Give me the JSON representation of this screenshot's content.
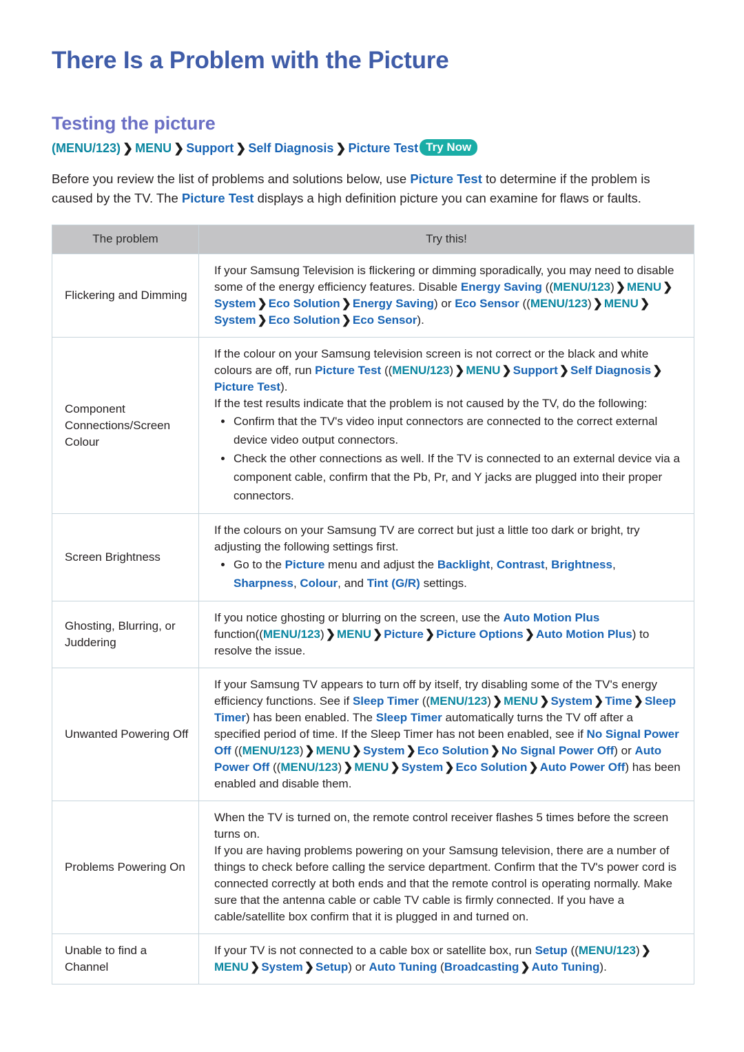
{
  "page": {
    "title": "There Is a Problem with the Picture",
    "section_title": "Testing the picture"
  },
  "breadcrumb": {
    "parts": [
      "(MENU/123)",
      "MENU",
      "Support",
      "Self Diagnosis",
      "Picture Test"
    ],
    "separator": "❯",
    "badge": "Try Now"
  },
  "intro": {
    "t1": "Before you review the list of problems and solutions below, use ",
    "k1": "Picture Test",
    "t2": " to determine if the problem is caused by the TV. The ",
    "k2": "Picture Test",
    "t3": " displays a high definition picture you can examine for flaws or faults."
  },
  "table": {
    "headers": [
      "The problem",
      "Try this!"
    ],
    "rows": [
      {
        "problem": "Flickering and Dimming",
        "solution_plain": "If your Samsung Television is flickering or dimming sporadically, you may need to disable some of the energy efficiency features. Disable Energy Saving ((MENU/123) ❯ MENU ❯ System ❯ Eco Solution ❯ Energy Saving) or Eco Sensor ((MENU/123) ❯ MENU ❯ System ❯ Eco Solution ❯ Eco Sensor).",
        "s": {
          "a": "If your Samsung Television is flickering or dimming sporadically, you may need to disable some of the energy efficiency features. Disable ",
          "b": "Energy Saving",
          "c": "MENU/123",
          "d": "MENU",
          "e": "System",
          "f": "Eco Solution",
          "g": "Energy Saving",
          "h": " or ",
          "i": "Eco Sensor",
          "j": "MENU/123",
          "k": "MENU",
          "l": "System",
          "m": "Eco Solution",
          "n": "Eco Sensor"
        }
      },
      {
        "problem": "Component Connections/Screen Colour",
        "solution_plain": "If the colour on your Samsung television screen is not correct or the black and white colours are off, run Picture Test ((MENU/123) ❯ MENU ❯ Support ❯ Self Diagnosis ❯ Picture Test). If the test results indicate that the problem is not caused by the TV, do the following:",
        "s": {
          "a": "If the colour on your Samsung television screen is not correct or the black and white colours are off, run ",
          "b": "Picture Test",
          "c": "MENU/123",
          "d": "MENU",
          "e": "Support",
          "f": "Self Diagnosis",
          "g": "Picture Test",
          "h": "If the test results indicate that the problem is not caused by the TV, do the following:"
        },
        "bullets": [
          "Confirm that the TV's video input connectors are connected to the correct external device video output connectors.",
          "Check the other connections as well. If the TV is connected to an external device via a component cable, confirm that the Pb, Pr, and Y jacks are plugged into their proper connectors."
        ]
      },
      {
        "problem": "Screen Brightness",
        "solution_plain": "If the colours on your Samsung TV are correct but just a little too dark or bright, try adjusting the following settings first.",
        "s": {
          "a": "If the colours on your Samsung TV are correct but just a little too dark or bright, try adjusting the following settings first.",
          "b": "Go to the ",
          "c": "Picture",
          "d": " menu and adjust the ",
          "e": "Backlight",
          "f": "Contrast",
          "g": "Brightness",
          "h": "Sharpness",
          "i": "Colour",
          "j": "Tint (G/R)",
          "k": " settings."
        }
      },
      {
        "problem": "Ghosting, Blurring, or Juddering",
        "solution_plain": "If you notice ghosting or blurring on the screen, use the Auto Motion Plus function((MENU/123) ❯ MENU ❯ Picture ❯ Picture Options ❯ Auto Motion Plus) to resolve the issue.",
        "s": {
          "a": "If you notice ghosting or blurring on the screen, use the ",
          "b": "Auto Motion Plus",
          "c": " function(",
          "d": "MENU/123",
          "e": "MENU",
          "f": "Picture",
          "g": "Picture Options",
          "h": "Auto Motion Plus",
          "i": " to resolve the issue."
        }
      },
      {
        "problem": "Unwanted Powering Off",
        "solution_plain": "If your Samsung TV appears to turn off by itself, try disabling some of the TV's energy efficiency functions. See if Sleep Timer ((MENU/123) ❯ MENU ❯ System ❯ Time ❯ Sleep Timer) has been enabled. The Sleep Timer automatically turns the TV off after a specified period of time. If the Sleep Timer has not been enabled, see if No Signal Power Off ((MENU/123) ❯ MENU ❯ System ❯ Eco Solution ❯ No Signal Power Off) or Auto Power Off ((MENU/123) ❯ MENU ❯ System ❯ Eco Solution ❯ Auto Power Off) has been enabled and disable them.",
        "s": {
          "a": "If your Samsung TV appears to turn off by itself, try disabling some of the TV's energy efficiency functions. See if ",
          "b": "Sleep Timer",
          "c": "MENU/123",
          "d": "MENU",
          "e": "System",
          "f": "Time",
          "g": "Sleep Timer",
          "h": " has been enabled. The ",
          "i": "Sleep Timer",
          "j": " automatically turns the TV off after a specified period of time. If the Sleep Timer has not been enabled, see if ",
          "k": "No Signal Power Off",
          "l": "MENU/123",
          "m": "MENU",
          "n": "System",
          "o": "Eco Solution",
          "p": "No Signal Power Off",
          "q": " or ",
          "r": "Auto Power Off",
          "s": "MENU/123",
          "t": "MENU",
          "u": "System",
          "v": "Eco Solution",
          "w": "Auto Power Off",
          "x": " has been enabled and disable them."
        }
      },
      {
        "problem": "Problems Powering On",
        "solution_plain": "When the TV is turned on, the remote control receiver flashes 5 times before the screen turns on. If you are having problems powering on your Samsung television, there are a number of things to check before calling the service department. Confirm that the TV's power cord is connected correctly at both ends and that the remote control is operating normally. Make sure that the antenna cable or cable TV cable is firmly connected. If you have a cable/satellite box confirm that it is plugged in and turned on.",
        "s": {
          "a": "When the TV is turned on, the remote control receiver flashes 5 times before the screen turns on.",
          "b": "If you are having problems powering on your Samsung television, there are a number of things to check before calling the service department. Confirm that the TV's power cord is connected correctly at both ends and that the remote control is operating normally. Make sure that the antenna cable or cable TV cable is firmly connected. If you have a cable/satellite box confirm that it is plugged in and turned on."
        }
      },
      {
        "problem": "Unable to find a Channel",
        "solution_plain": "If your TV is not connected to a cable box or satellite box, run Setup ((MENU/123) ❯ MENU ❯ System ❯ Setup) or Auto Tuning (Broadcasting ❯ Auto Tuning).",
        "s": {
          "a": "If your TV is not connected to a cable box or satellite box, run ",
          "b": "Setup",
          "c": "MENU/123",
          "d": "MENU",
          "e": "System",
          "f": "Setup",
          "g": " or ",
          "h": "Auto Tuning",
          "i": "Broadcasting",
          "j": "Auto Tuning"
        }
      }
    ]
  },
  "colors": {
    "title": "#3f5ca8",
    "section_title": "#6a6fc4",
    "link_blue": "#1763b4",
    "link_teal": "#0a86a0",
    "badge_bg": "#1aada6",
    "table_header_bg": "#c4c4c6",
    "table_border": "#c7d5dc"
  }
}
